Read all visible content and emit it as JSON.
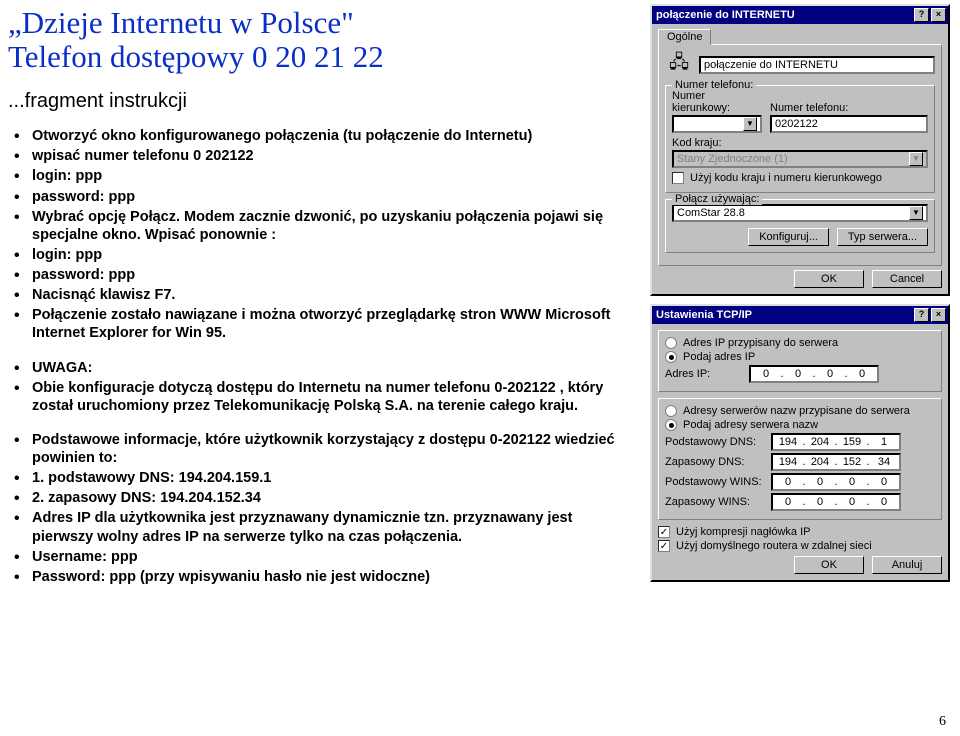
{
  "title_line1": "„Dzieje Internetu w Polsce\"",
  "title_line2": "Telefon dostępowy 0 20 21 22",
  "subtitle": "...fragment instrukcji",
  "bullets": [
    "Otworzyć okno konfigurowanego połączenia (tu połączenie do Internetu)",
    "wpisać numer telefonu 0 202122",
    "login: ppp",
    "password: ppp",
    "Wybrać opcję Połącz. Modem zacznie dzwonić, po uzyskaniu połączenia pojawi się specjalne okno. Wpisać ponownie :",
    "login: ppp",
    "password: ppp",
    "Nacisnąć klawisz F7.",
    "Połączenie zostało nawiązane i można otworzyć przeglądarkę stron WWW Microsoft Internet Explorer for Win 95."
  ],
  "bullets2": [
    "UWAGA:",
    "Obie konfiguracje dotyczą dostępu do Internetu na numer telefonu 0-202122 , który został uruchomiony przez Telekomunikację Polską S.A. na terenie całego kraju.",
    "Podstawowe informacje, które użytkownik korzystający z dostępu 0-202122 wiedzieć powinien to:",
    "1. podstawowy DNS: 194.204.159.1",
    "2. zapasowy DNS: 194.204.152.34",
    "Adres IP dla użytkownika jest przyznawany dynamicznie tzn. przyznawany jest pierwszy wolny adres IP na serwerze tylko na czas połączenia.",
    "Username: ppp",
    "Password: ppp (przy wpisywaniu hasło nie jest widoczne)"
  ],
  "page_number": "6",
  "dialog1": {
    "title": "połączenie do INTERNETU",
    "tab": "Ogólne",
    "head_label": "połączenie do INTERNETU",
    "phone_group": "Numer telefonu:",
    "area_label": "Numer kierunkowy:",
    "area_value": "",
    "number_label": "Numer telefonu:",
    "number_value": "0202122",
    "country_label": "Kod kraju:",
    "country_value": "Stany Zjednoczone (1)",
    "use_area_checkbox": "Użyj kodu kraju i numeru kierunkowego",
    "connect_group": "Połącz używając:",
    "modem": "ComStar 28.8",
    "btn_config": "Konfiguruj...",
    "btn_type": "Typ serwera...",
    "btn_ok": "OK",
    "btn_cancel": "Cancel"
  },
  "dialog2": {
    "title": "Ustawienia TCP/IP",
    "ip_auto": "Adres IP przypisany do serwera",
    "ip_manual": "Podaj adres IP",
    "ip_label": "Adres IP:",
    "ip_value": [
      "0",
      "0",
      "0",
      "0"
    ],
    "dns_auto": "Adresy serwerów nazw przypisane do serwera",
    "dns_manual": "Podaj adresy serwera nazw",
    "pdns_label": "Podstawowy DNS:",
    "pdns_value": [
      "194",
      "204",
      "159",
      "1"
    ],
    "zdns_label": "Zapasowy DNS:",
    "zdns_value": [
      "194",
      "204",
      "152",
      "34"
    ],
    "pwins_label": "Podstawowy WINS:",
    "pwins_value": [
      "0",
      "0",
      "0",
      "0"
    ],
    "zwins_label": "Zapasowy WINS:",
    "zwins_value": [
      "0",
      "0",
      "0",
      "0"
    ],
    "cb_header": "Użyj kompresji nagłówka IP",
    "cb_gateway": "Użyj domyślnego routera w zdalnej sieci",
    "btn_ok": "OK",
    "btn_cancel": "Anuluj"
  }
}
